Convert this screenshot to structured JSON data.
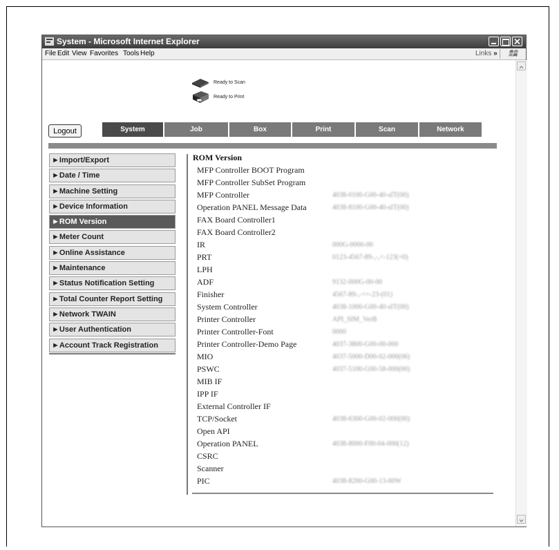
{
  "window": {
    "title": "System - Microsoft Internet Explorer"
  },
  "menu": [
    "File",
    "Edit",
    "View",
    "Favorites",
    "Tools",
    "Help"
  ],
  "links_label": "Links",
  "links_chevron": "»",
  "status": {
    "scan": "Ready to Scan",
    "print": "Ready to Print"
  },
  "logout_label": "Logout",
  "tabs": [
    {
      "label": "System",
      "active": true
    },
    {
      "label": "Job",
      "active": false
    },
    {
      "label": "Box",
      "active": false
    },
    {
      "label": "Print",
      "active": false
    },
    {
      "label": "Scan",
      "active": false
    },
    {
      "label": "Network",
      "active": false
    }
  ],
  "sidebar": [
    {
      "label": "Import/Export",
      "active": false
    },
    {
      "label": "Date / Time",
      "active": false
    },
    {
      "label": "Machine Setting",
      "active": false
    },
    {
      "label": "Device Information",
      "active": false
    },
    {
      "label": "ROM Version",
      "active": true
    },
    {
      "label": "Meter Count",
      "active": false
    },
    {
      "label": "Online Assistance",
      "active": false
    },
    {
      "label": "Maintenance",
      "active": false
    },
    {
      "label": "Status Notification Setting",
      "active": false
    },
    {
      "label": "Total Counter Report Setting",
      "active": false
    },
    {
      "label": "Network TWAIN",
      "active": false
    },
    {
      "label": "User Authentication",
      "active": false
    },
    {
      "label": "Account Track Registration",
      "active": false
    }
  ],
  "content": {
    "title": "ROM Version",
    "rows": [
      {
        "label": "MFP Controller BOOT Program",
        "value": ""
      },
      {
        "label": "MFP Controller SubSet Program",
        "value": ""
      },
      {
        "label": "MFP Controller",
        "value": "4038-0100-G00-40-sIT(00)"
      },
      {
        "label": "Operation PANEL Message Data",
        "value": "4038-8100-G00-40-sIT(00)"
      },
      {
        "label": "FAX Board Controller1",
        "value": ""
      },
      {
        "label": "FAX Board Controller2",
        "value": ""
      },
      {
        "label": "IR",
        "value": "000G-0000-00"
      },
      {
        "label": "PRT",
        "value": "0123-4567-89-,-,<-123(=0)"
      },
      {
        "label": "LPH",
        "value": ""
      },
      {
        "label": "ADF",
        "value": "9132-000G-00-00"
      },
      {
        "label": "Finisher",
        "value": "4567-89-,-<=-23-(01)"
      },
      {
        "label": "System Controller",
        "value": "4038-1000-G00-40-sIT(00)"
      },
      {
        "label": "Printer Controller",
        "value": "API_SIM_VerB"
      },
      {
        "label": "Printer Controller-Font",
        "value": "0000"
      },
      {
        "label": "Printer Controller-Demo Page",
        "value": "4037-3800-G00-00-000"
      },
      {
        "label": "MIO",
        "value": "4037-5000-D00-02-000(06)"
      },
      {
        "label": "PSWC",
        "value": "4037-5100-G00-58-000(00)"
      },
      {
        "label": "MIB IF",
        "value": ""
      },
      {
        "label": "IPP IF",
        "value": ""
      },
      {
        "label": "External Controller IF",
        "value": ""
      },
      {
        "label": "TCP/Socket",
        "value": "4038-6300-G00-02-000(00)"
      },
      {
        "label": "Open API",
        "value": ""
      },
      {
        "label": "Operation PANEL",
        "value": "4038-8000-F00-04-000(12)"
      },
      {
        "label": "CSRC",
        "value": ""
      },
      {
        "label": "Scanner",
        "value": ""
      },
      {
        "label": "PIC",
        "value": "4038-8200-G00-13-00W"
      }
    ]
  },
  "colors": {
    "tab_bg": "#7a7a7a",
    "tab_active_bg": "#4a4a4a",
    "sidebar_active_bg": "#5a5a5a",
    "accent_bar": "#8a8a8a"
  }
}
